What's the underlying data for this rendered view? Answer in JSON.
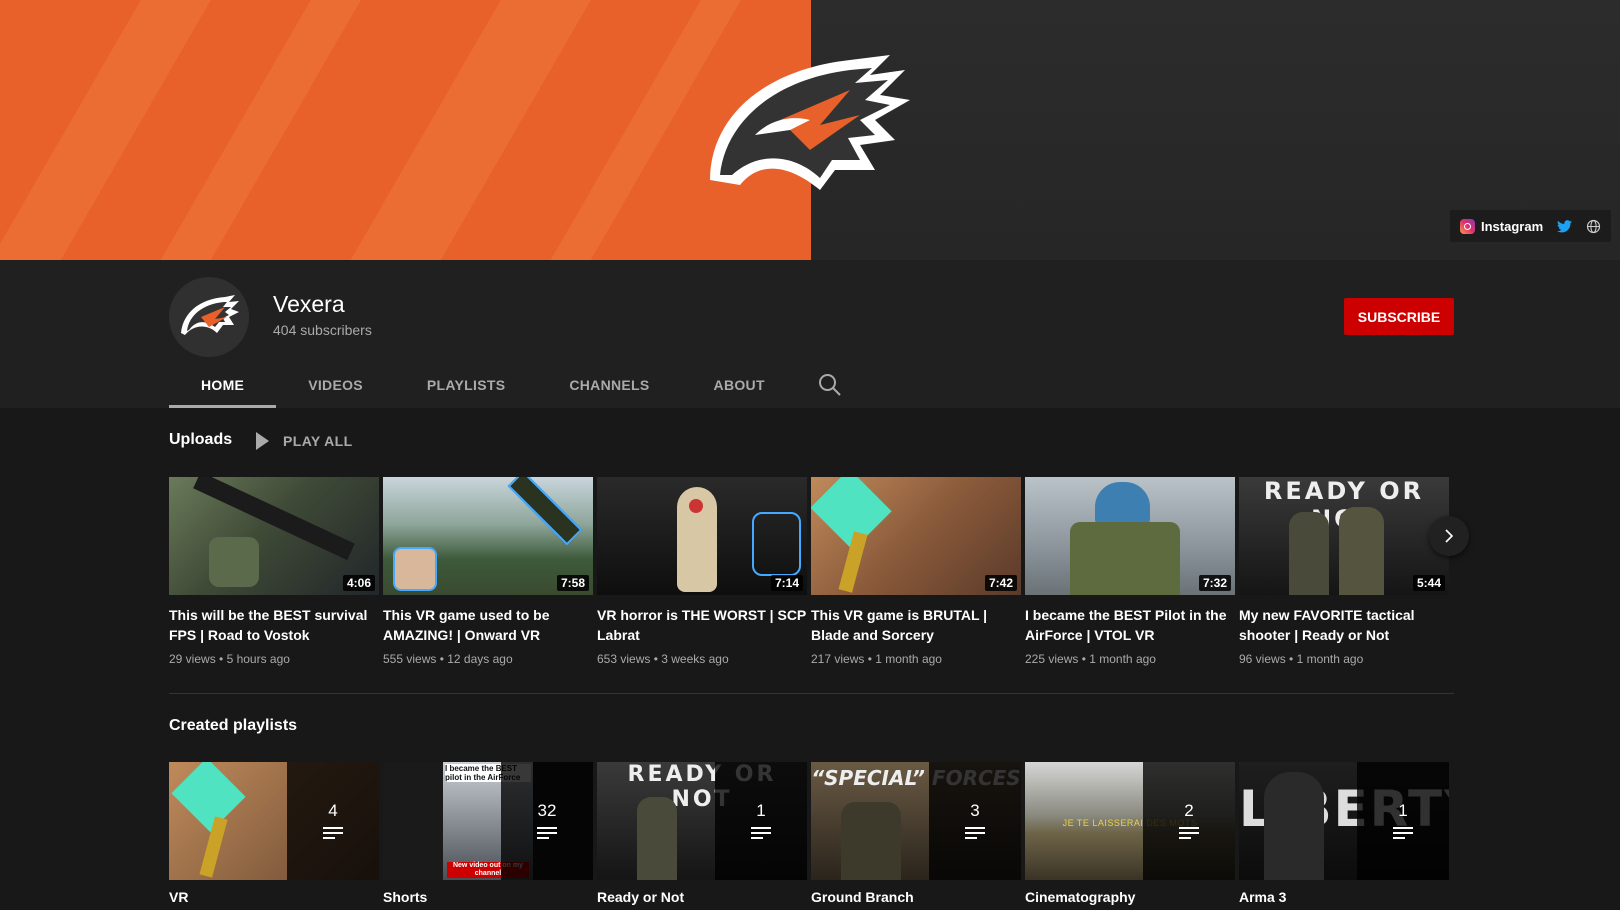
{
  "banner": {
    "links": [
      {
        "icon": "instagram-icon",
        "label": "Instagram"
      },
      {
        "icon": "twitter-icon",
        "label": ""
      },
      {
        "icon": "globe-icon",
        "label": ""
      }
    ]
  },
  "channel": {
    "name": "Vexera",
    "subscribers": "404 subscribers",
    "subscribe_label": "SUBSCRIBE"
  },
  "tabs": [
    {
      "label": "HOME",
      "active": true
    },
    {
      "label": "VIDEOS",
      "active": false
    },
    {
      "label": "PLAYLISTS",
      "active": false
    },
    {
      "label": "CHANNELS",
      "active": false
    },
    {
      "label": "ABOUT",
      "active": false
    }
  ],
  "uploads": {
    "title": "Uploads",
    "play_all": "PLAY ALL",
    "videos": [
      {
        "title": "This will be the BEST survival FPS | Road to Vostok",
        "duration": "4:06",
        "views": "29 views",
        "age": "5 hours ago"
      },
      {
        "title": "This VR game used to be AMAZING! | Onward VR",
        "duration": "7:58",
        "views": "555 views",
        "age": "12 days ago"
      },
      {
        "title": "VR horror is THE WORST | SCP Labrat",
        "duration": "7:14",
        "views": "653 views",
        "age": "3 weeks ago"
      },
      {
        "title": "This VR game is BRUTAL | Blade and Sorcery",
        "duration": "7:42",
        "views": "217 views",
        "age": "1 month ago"
      },
      {
        "title": "I became the BEST Pilot in the AirForce | VTOL VR",
        "duration": "7:32",
        "views": "225 views",
        "age": "1 month ago"
      },
      {
        "title": "My new FAVORITE tactical shooter | Ready or Not",
        "duration": "5:44",
        "views": "96 views",
        "age": "1 month ago",
        "thumb_text": "READY OR NOT"
      }
    ]
  },
  "playlists": {
    "title": "Created playlists",
    "items": [
      {
        "name": "VR",
        "count": "4"
      },
      {
        "name": "Shorts",
        "count": "32",
        "thumb_text": "I became the BEST pilot in the AirForce",
        "thumb_sub": "New video out on my channel"
      },
      {
        "name": "Ready or Not",
        "count": "1",
        "thumb_text": "READY OR NOT"
      },
      {
        "name": "Ground Branch",
        "count": "3",
        "thumb_text": "“SPECIAL” FORCES"
      },
      {
        "name": "Cinematography",
        "count": "2",
        "thumb_text": "JE TE LAISSERAI DES MOTS"
      },
      {
        "name": "Arma 3",
        "count": "1",
        "thumb_text": "LIBERTY"
      }
    ]
  },
  "colors": {
    "banner_orange": "#e8612a",
    "subscribe_red": "#cc0000",
    "background": "#181818",
    "header": "#202020"
  }
}
